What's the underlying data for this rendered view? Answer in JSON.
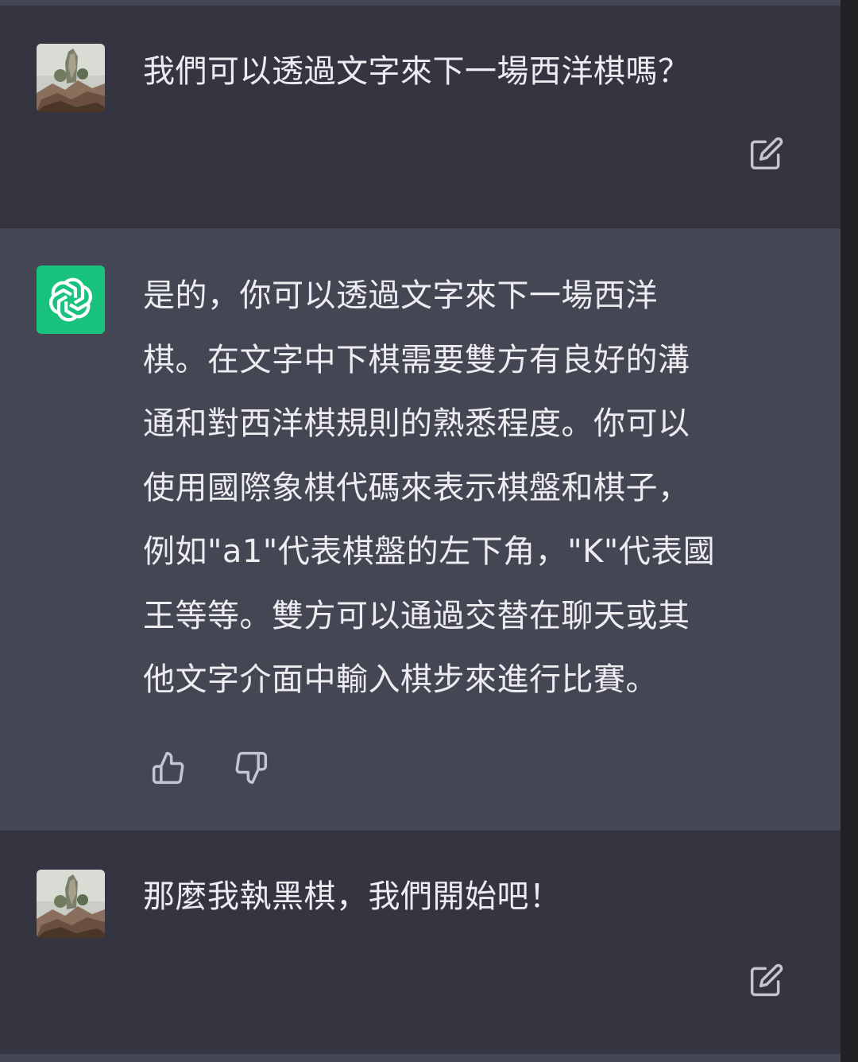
{
  "conversation": {
    "messages": [
      {
        "role": "user",
        "avatar_icon": "user-avatar-photo",
        "text": "我們可以透過文字來下一場西洋棋嗎？",
        "action_icon": "edit-icon"
      },
      {
        "role": "assistant",
        "avatar_icon": "openai-logo-icon",
        "avatar_color": "#19c37d",
        "text": "是的，你可以透過文字來下一場西洋棋。在文字中下棋需要雙方有良好的溝通和對西洋棋規則的熟悉程度。你可以使用國際象棋代碼來表示棋盤和棋子，例如\"a1\"代表棋盤的左下角，\"K\"代表國王等等。雙方可以通過交替在聊天或其他文字介面中輸入棋步來進行比賽。",
        "lines": [
          "是的，你可以透過文字來下一場西洋",
          "棋。在文字中下棋需要雙方有良好的溝",
          "通和對西洋棋規則的熟悉程度。你可以",
          "使用國際象棋代碼來表示棋盤和棋子，",
          "例如\"a1\"代表棋盤的左下角，\"K\"代表國",
          "王等等。雙方可以通過交替在聊天或其",
          "他文字介面中輸入棋步來進行比賽。"
        ],
        "feedback_icons": [
          "thumbs-up-icon",
          "thumbs-down-icon"
        ]
      },
      {
        "role": "user",
        "avatar_icon": "user-avatar-photo",
        "text": "那麼我執黑棋，我們開始吧！",
        "action_icon": "edit-icon"
      }
    ]
  },
  "theme": {
    "user_bg": "#343541",
    "assistant_bg": "#444654",
    "text_color": "#ececf1",
    "icon_color": "#c5c5d2",
    "brand_green": "#19c37d"
  }
}
